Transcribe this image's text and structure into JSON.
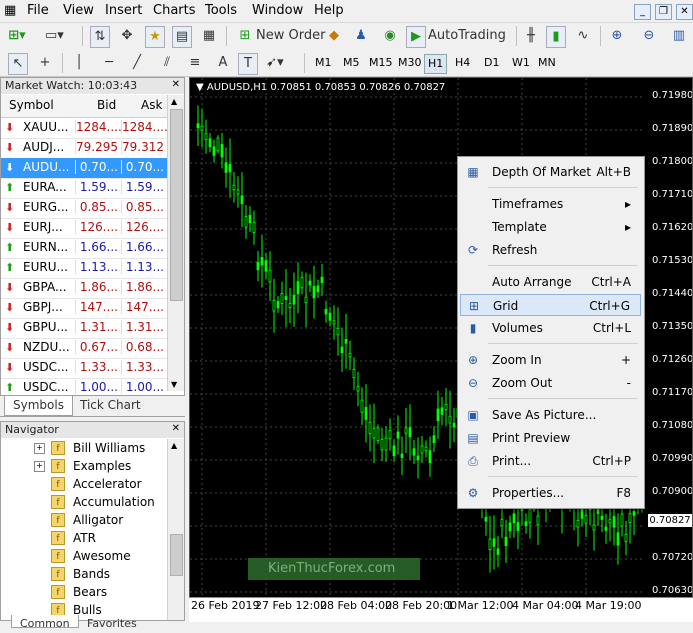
{
  "menu": [
    "File",
    "View",
    "Insert",
    "Charts",
    "Tools",
    "Window",
    "Help"
  ],
  "toolbar": {
    "new_order": "New Order",
    "autotrading": "AutoTrading",
    "timeframes": [
      "M1",
      "M5",
      "M15",
      "M30",
      "H1",
      "H4",
      "D1",
      "W1",
      "MN"
    ],
    "active_timeframe": "H1"
  },
  "market_watch": {
    "title": "Market Watch: 10:03:43",
    "columns": {
      "symbol": "Symbol",
      "bid": "Bid",
      "ask": "Ask"
    },
    "rows": [
      {
        "dir": "down",
        "symbol": "XAUU...",
        "bid": "1284....",
        "ask": "1284....",
        "color": "red"
      },
      {
        "dir": "down",
        "symbol": "AUDJ...",
        "bid": "79.295",
        "ask": "79.312",
        "color": "red"
      },
      {
        "dir": "down",
        "symbol": "AUDU...",
        "bid": "0.70...",
        "ask": "0.70...",
        "color": "sel"
      },
      {
        "dir": "up",
        "symbol": "EURA...",
        "bid": "1.59...",
        "ask": "1.59...",
        "color": "blue"
      },
      {
        "dir": "down",
        "symbol": "EURG...",
        "bid": "0.85...",
        "ask": "0.85...",
        "color": "red"
      },
      {
        "dir": "down",
        "symbol": "EURJ...",
        "bid": "126....",
        "ask": "126....",
        "color": "red"
      },
      {
        "dir": "up",
        "symbol": "EURN...",
        "bid": "1.66...",
        "ask": "1.66...",
        "color": "blue"
      },
      {
        "dir": "up",
        "symbol": "EURU...",
        "bid": "1.13...",
        "ask": "1.13...",
        "color": "blue"
      },
      {
        "dir": "down",
        "symbol": "GBPA...",
        "bid": "1.86...",
        "ask": "1.86...",
        "color": "red"
      },
      {
        "dir": "down",
        "symbol": "GBPJ...",
        "bid": "147....",
        "ask": "147....",
        "color": "red"
      },
      {
        "dir": "down",
        "symbol": "GBPU...",
        "bid": "1.31...",
        "ask": "1.31...",
        "color": "red"
      },
      {
        "dir": "down",
        "symbol": "NZDU...",
        "bid": "0.67...",
        "ask": "0.68...",
        "color": "red"
      },
      {
        "dir": "down",
        "symbol": "USDC...",
        "bid": "1.33...",
        "ask": "1.33...",
        "color": "red"
      },
      {
        "dir": "up",
        "symbol": "USDC...",
        "bid": "1.00...",
        "ask": "1.00...",
        "color": "blue"
      }
    ],
    "tabs": [
      "Symbols",
      "Tick Chart"
    ]
  },
  "navigator": {
    "title": "Navigator",
    "items": [
      "Bill Williams",
      "Examples",
      "Accelerator",
      "Accumulation",
      "Alligator",
      "ATR",
      "Awesome",
      "Bands",
      "Bears",
      "Bulls"
    ],
    "tabs": [
      "Common",
      "Favorites"
    ]
  },
  "chart": {
    "title": "AUDUSD,H1  0.70851 0.70853 0.70826 0.70827",
    "current_price": "0.70827",
    "price_ticks": [
      "0.71980",
      "0.71890",
      "0.71800",
      "0.71710",
      "0.71620",
      "0.71530",
      "0.71440",
      "0.71350",
      "0.71260",
      "0.71170",
      "0.71080",
      "0.70990",
      "0.70900",
      "0.70810",
      "0.70720",
      "0.70630"
    ],
    "date_ticks": [
      "26 Feb 2019",
      "27 Feb 12:00",
      "28 Feb 04:00",
      "28 Feb 20:00",
      "1 Mar 12:00",
      "4 Mar 04:00",
      "4 Mar 19:00"
    ],
    "watermark": "KienThucForex.com",
    "colors": {
      "background": "#000000",
      "candles": "#00ff00",
      "grid": "#3a3a3a"
    }
  },
  "context_menu": [
    {
      "icon": "grid-table-icon",
      "label": "Depth Of Market",
      "key": "Alt+B"
    },
    {
      "sep": true
    },
    {
      "icon": "",
      "label": "Timeframes",
      "key": "▸"
    },
    {
      "icon": "",
      "label": "Template",
      "key": "▸"
    },
    {
      "icon": "refresh-icon",
      "label": "Refresh",
      "key": ""
    },
    {
      "sep": true
    },
    {
      "icon": "",
      "label": "Auto Arrange",
      "key": "Ctrl+A"
    },
    {
      "icon": "grid-icon",
      "label": "Grid",
      "key": "Ctrl+G",
      "highlight": true
    },
    {
      "icon": "volumes-icon",
      "label": "Volumes",
      "key": "Ctrl+L"
    },
    {
      "sep": true
    },
    {
      "icon": "zoom-in-icon",
      "label": "Zoom In",
      "key": "+"
    },
    {
      "icon": "zoom-out-icon",
      "label": "Zoom Out",
      "key": "-"
    },
    {
      "sep": true
    },
    {
      "icon": "save-picture-icon",
      "label": "Save As Picture...",
      "key": ""
    },
    {
      "icon": "print-preview-icon",
      "label": "Print Preview",
      "key": ""
    },
    {
      "icon": "print-icon",
      "label": "Print...",
      "key": "Ctrl+P"
    },
    {
      "sep": true
    },
    {
      "icon": "properties-icon",
      "label": "Properties...",
      "key": "F8"
    }
  ]
}
